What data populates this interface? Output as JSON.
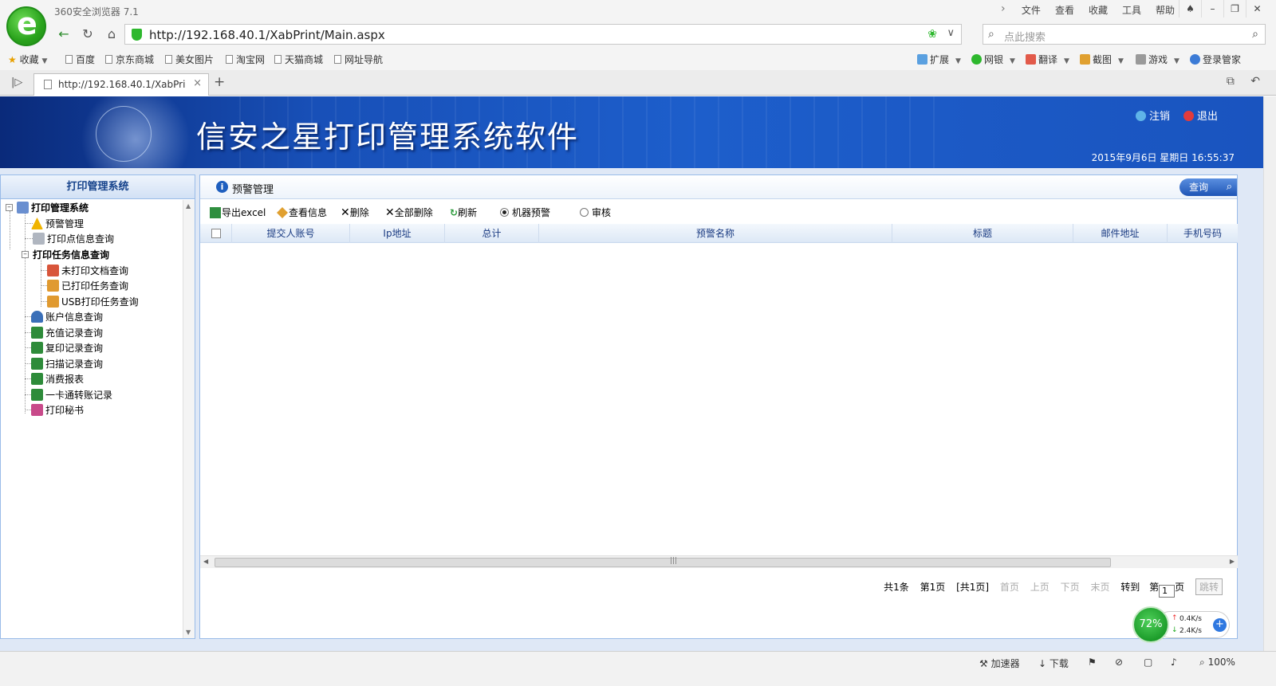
{
  "browser": {
    "title": "360安全浏览器 7.1",
    "menu": [
      "文件",
      "查看",
      "收藏",
      "工具",
      "帮助"
    ],
    "url": "http://192.168.40.1/XabPrint/Main.aspx",
    "search_placeholder": "点此搜索",
    "favorites": [
      "收藏",
      "百度",
      "京东商城",
      "美女图片",
      "淘宝网",
      "天猫商城",
      "网址导航"
    ],
    "tools": [
      "扩展",
      "网银",
      "翻译",
      "截图",
      "游戏",
      "登录管家"
    ],
    "tab_title": "http://192.168.40.1/XabPrint/",
    "status": {
      "accelerator": "加速器",
      "download": "下载",
      "zoom": "100%"
    },
    "speed_widget": {
      "percent": "72%",
      "up": "0.4K/s",
      "down": "2.4K/s"
    }
  },
  "app": {
    "banner_title": "信安之星打印管理系统软件",
    "logout_label": "注销",
    "exit_label": "退出",
    "datetime": "2015年9月6日  星期日  16:55:37",
    "left_title": "打印管理系统",
    "tree": {
      "root": "打印管理系统",
      "alert_mgmt": "预警管理",
      "print_point": "打印点信息查询",
      "task_group": "打印任务信息查询",
      "unprinted": "未打印文档查询",
      "printed": "已打印任务查询",
      "usb": "USB打印任务查询",
      "account": "账户信息查询",
      "recharge": "充值记录查询",
      "copy": "复印记录查询",
      "scan": "扫描记录查询",
      "consume": "消费报表",
      "card_transfer": "一卡通转账记录",
      "secretary": "打印秘书"
    },
    "panel_title": "预警管理",
    "query_label": "查询",
    "toolbar": {
      "export": "导出excel",
      "view": "查看信息",
      "delete": "删除",
      "delete_all": "全部删除",
      "refresh": "刷新",
      "radio_machine": "机器预警",
      "radio_audit": "审核"
    },
    "columns": [
      "提交人账号",
      "Ip地址",
      "总计",
      "预警名称",
      "标题",
      "邮件地址",
      "手机号码"
    ],
    "pager": {
      "total": "共1条",
      "current": "第1页",
      "pages": "[共1页]",
      "first": "首页",
      "prev": "上页",
      "next": "下页",
      "last": "末页",
      "goto": "转到",
      "page_prefix": "第",
      "page_value": "1",
      "page_suffix": "页",
      "jump": "跳转"
    }
  }
}
